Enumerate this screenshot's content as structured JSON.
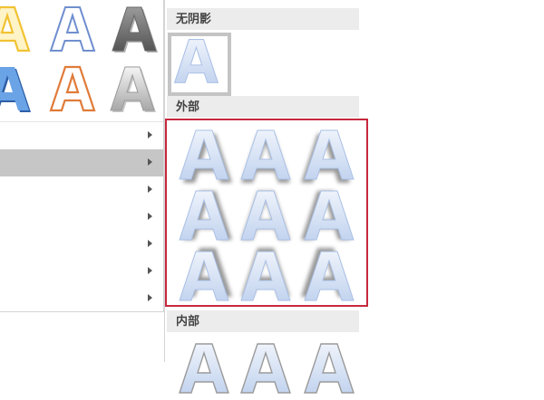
{
  "effect_styles": [
    {
      "icon": "letter-a-yellow-outline-icon",
      "color": "#f1c232"
    },
    {
      "icon": "letter-a-blue-outline-icon",
      "color": "#6f8fcf"
    },
    {
      "icon": "letter-a-gray-bevel-icon",
      "color": "#777777"
    },
    {
      "icon": "letter-a-blue-shadow-icon",
      "color": "#4a86d4"
    },
    {
      "icon": "letter-a-orange-outline-icon",
      "color": "#e07b39"
    },
    {
      "icon": "letter-a-silver-gradient-icon",
      "color": "#9a9a9a"
    }
  ],
  "submenu": {
    "items": [
      {
        "highlighted": false
      },
      {
        "highlighted": true
      },
      {
        "highlighted": false
      },
      {
        "highlighted": false
      },
      {
        "highlighted": false
      },
      {
        "highlighted": false
      },
      {
        "highlighted": false
      }
    ]
  },
  "shadow_gallery": {
    "no_shadow": {
      "label": "无阴影",
      "options": [
        {
          "icon": "letter-a-no-shadow-icon",
          "selected": true
        }
      ]
    },
    "outer": {
      "label": "外部",
      "frame_color": "#c5283d",
      "options": [
        {
          "icon": "letter-a-outer-shadow-diag-bottom-right-icon"
        },
        {
          "icon": "letter-a-outer-shadow-bottom-icon"
        },
        {
          "icon": "letter-a-outer-shadow-diag-bottom-left-icon"
        },
        {
          "icon": "letter-a-outer-shadow-right-icon"
        },
        {
          "icon": "letter-a-outer-shadow-center-icon"
        },
        {
          "icon": "letter-a-outer-shadow-left-icon"
        },
        {
          "icon": "letter-a-outer-shadow-diag-top-right-icon"
        },
        {
          "icon": "letter-a-outer-shadow-top-icon"
        },
        {
          "icon": "letter-a-outer-shadow-diag-top-left-icon"
        }
      ]
    },
    "inner": {
      "label": "内部",
      "options": [
        {
          "icon": "letter-a-inner-shadow-icon"
        },
        {
          "icon": "letter-a-inner-shadow-icon"
        },
        {
          "icon": "letter-a-inner-shadow-icon"
        }
      ]
    }
  }
}
